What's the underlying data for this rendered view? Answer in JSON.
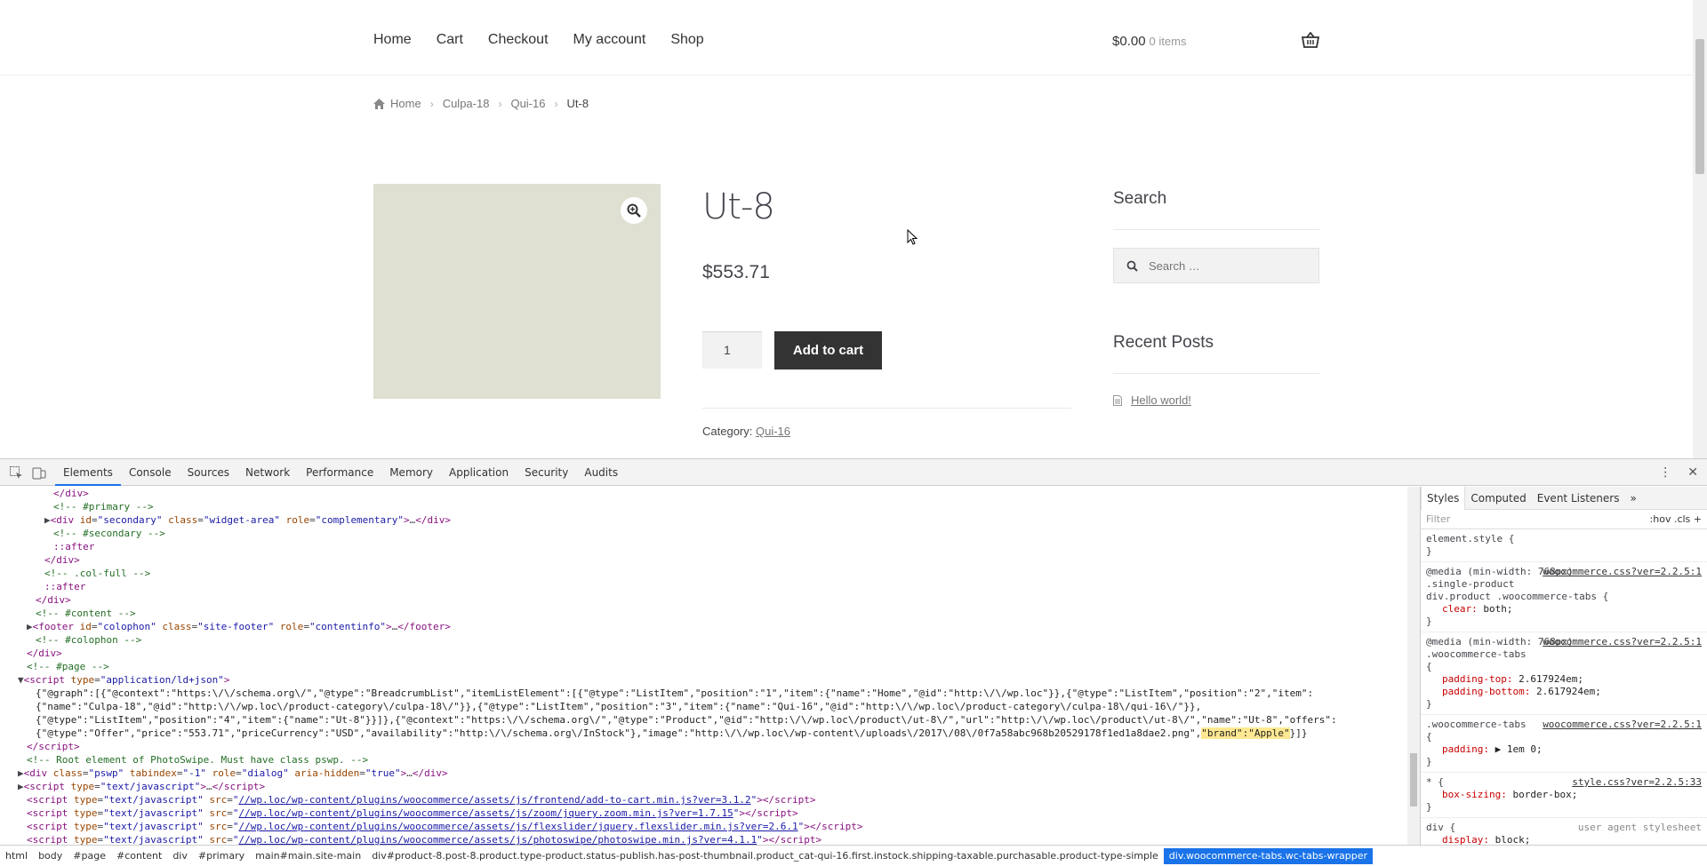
{
  "nav": [
    "Home",
    "Cart",
    "Checkout",
    "My account",
    "Shop"
  ],
  "cart": {
    "amount": "$0.00",
    "items": "0 items"
  },
  "breadcrumb": {
    "home": "Home",
    "c1": "Culpa-18",
    "c2": "Qui-16",
    "current": "Ut-8"
  },
  "product": {
    "title": "Ut-8",
    "price": "$553.71",
    "qty": "1",
    "add_to_cart": "Add to cart",
    "category_label": "Category:",
    "category": "Qui-16",
    "image_color": "#dfe0d2"
  },
  "sidebar": {
    "search_title": "Search",
    "search_placeholder": "Search …",
    "recent_title": "Recent Posts",
    "post": "Hello world!"
  },
  "devtools": {
    "tabs": [
      "Elements",
      "Console",
      "Sources",
      "Network",
      "Performance",
      "Memory",
      "Application",
      "Security",
      "Audits"
    ],
    "dom_lines": [
      {
        "indent": 6,
        "html": "<span class=\"tag\">&lt;/div&gt;</span>"
      },
      {
        "indent": 6,
        "html": "<span class=\"cmt\">&lt;!-- #primary --&gt;</span>"
      },
      {
        "indent": 5,
        "html": "▶<span class=\"tag\">&lt;div </span><span class=\"attr\">id</span>=<span class=\"val\">\"secondary\"</span> <span class=\"attr\">class</span>=<span class=\"val\">\"widget-area\"</span> <span class=\"attr\">role</span>=<span class=\"val\">\"complementary\"</span><span class=\"tag\">&gt;</span>…<span class=\"tag\">&lt;/div&gt;</span>"
      },
      {
        "indent": 6,
        "html": "<span class=\"cmt\">&lt;!-- #secondary --&gt;</span>"
      },
      {
        "indent": 6,
        "html": "<span class=\"pseudo\">::after</span>"
      },
      {
        "indent": 5,
        "html": "<span class=\"tag\">&lt;/div&gt;</span>"
      },
      {
        "indent": 5,
        "html": "<span class=\"cmt\">&lt;!-- .col-full --&gt;</span>"
      },
      {
        "indent": 5,
        "html": "<span class=\"pseudo\">::after</span>"
      },
      {
        "indent": 4,
        "html": "<span class=\"tag\">&lt;/div&gt;</span>"
      },
      {
        "indent": 4,
        "html": "<span class=\"cmt\">&lt;!-- #content --&gt;</span>"
      },
      {
        "indent": 3,
        "html": "▶<span class=\"tag\">&lt;footer </span><span class=\"attr\">id</span>=<span class=\"val\">\"colophon\"</span> <span class=\"attr\">class</span>=<span class=\"val\">\"site-footer\"</span> <span class=\"attr\">role</span>=<span class=\"val\">\"contentinfo\"</span><span class=\"tag\">&gt;</span>…<span class=\"tag\">&lt;/footer&gt;</span>"
      },
      {
        "indent": 4,
        "html": "<span class=\"cmt\">&lt;!-- #colophon --&gt;</span>"
      },
      {
        "indent": 3,
        "html": "<span class=\"tag\">&lt;/div&gt;</span>"
      },
      {
        "indent": 3,
        "html": "<span class=\"cmt\">&lt;!-- #page --&gt;</span>"
      },
      {
        "indent": 2,
        "html": "▼<span class=\"tag\">&lt;script </span><span class=\"attr\">type</span>=<span class=\"val\">\"application/ld+json\"</span><span class=\"tag\">&gt;</span>"
      },
      {
        "indent": 4,
        "html": "<span class=\"txt\">{\"@graph\":[{\"@context\":\"https:\\/\\/schema.org\\/\",\"@type\":\"BreadcrumbList\",\"itemListElement\":[{\"@type\":\"ListItem\",\"position\":\"1\",\"item\":{\"name\":\"Home\",\"@id\":\"http:\\/\\/wp.loc\"}},{\"@type\":\"ListItem\",\"position\":\"2\",\"item\":</span>"
      },
      {
        "indent": 4,
        "html": "<span class=\"txt\">{\"name\":\"Culpa-18\",\"@id\":\"http:\\/\\/wp.loc\\/product-category\\/culpa-18\\/\"}},{\"@type\":\"ListItem\",\"position\":\"3\",\"item\":{\"name\":\"Qui-16\",\"@id\":\"http:\\/\\/wp.loc\\/product-category\\/culpa-18\\/qui-16\\/\"}},</span>"
      },
      {
        "indent": 4,
        "html": "<span class=\"txt\">{\"@type\":\"ListItem\",\"position\":\"4\",\"item\":{\"name\":\"Ut-8\"}}]},{\"@context\":\"https:\\/\\/schema.org\\/\",\"@type\":\"Product\",\"@id\":\"http:\\/\\/wp.loc\\/product\\/ut-8\\/\",\"url\":\"http:\\/\\/wp.loc\\/product\\/ut-8\\/\",\"name\":\"Ut-8\",\"offers\":</span>"
      },
      {
        "indent": 4,
        "html": "<span class=\"txt\">{\"@type\":\"Offer\",\"price\":\"553.71\",\"priceCurrency\":\"USD\",\"availability\":\"http:\\/\\/schema.org\\/InStock\"},\"image\":\"http:\\/\\/wp.loc\\/wp-content\\/uploads\\/2017\\/08\\/0f7a58abc968b20529178f1ed1a8dae2.png\",</span><span class=\"txt hl\">\"brand\":\"Apple\"</span><span class=\"txt\">}]}</span>"
      },
      {
        "indent": 3,
        "html": "<span class=\"tag\">&lt;/script&gt;</span>"
      },
      {
        "indent": 3,
        "html": "<span class=\"cmt\">&lt;!-- Root element of PhotoSwipe. Must have class pswp. --&gt;</span>"
      },
      {
        "indent": 2,
        "html": "▶<span class=\"tag\">&lt;div </span><span class=\"attr\">class</span>=<span class=\"val\">\"pswp\"</span> <span class=\"attr\">tabindex</span>=<span class=\"val\">\"-1\"</span> <span class=\"attr\">role</span>=<span class=\"val\">\"dialog\"</span> <span class=\"attr\">aria-hidden</span>=<span class=\"val\">\"true\"</span><span class=\"tag\">&gt;</span>…<span class=\"tag\">&lt;/div&gt;</span>"
      },
      {
        "indent": 2,
        "html": "▶<span class=\"tag\">&lt;script </span><span class=\"attr\">type</span>=<span class=\"val\">\"text/javascript\"</span><span class=\"tag\">&gt;</span>…<span class=\"tag\">&lt;/script&gt;</span>"
      },
      {
        "indent": 3,
        "html": "<span class=\"tag\">&lt;script </span><span class=\"attr\">type</span>=<span class=\"val\">\"text/javascript\"</span> <span class=\"attr\">src</span>=<span class=\"val\">\"</span><span class=\"link\">//wp.loc/wp-content/plugins/woocommerce/assets/js/frontend/add-to-cart.min.js?ver=3.1.2</span><span class=\"val\">\"</span><span class=\"tag\">&gt;&lt;/script&gt;</span>"
      },
      {
        "indent": 3,
        "html": "<span class=\"tag\">&lt;script </span><span class=\"attr\">type</span>=<span class=\"val\">\"text/javascript\"</span> <span class=\"attr\">src</span>=<span class=\"val\">\"</span><span class=\"link\">//wp.loc/wp-content/plugins/woocommerce/assets/js/zoom/jquery.zoom.min.js?ver=1.7.15</span><span class=\"val\">\"</span><span class=\"tag\">&gt;&lt;/script&gt;</span>"
      },
      {
        "indent": 3,
        "html": "<span class=\"tag\">&lt;script </span><span class=\"attr\">type</span>=<span class=\"val\">\"text/javascript\"</span> <span class=\"attr\">src</span>=<span class=\"val\">\"</span><span class=\"link\">//wp.loc/wp-content/plugins/woocommerce/assets/js/flexslider/jquery.flexslider.min.js?ver=2.6.1</span><span class=\"val\">\"</span><span class=\"tag\">&gt;&lt;/script&gt;</span>"
      },
      {
        "indent": 3,
        "html": "<span class=\"tag\">&lt;script </span><span class=\"attr\">type</span>=<span class=\"val\">\"text/javascript\"</span> <span class=\"attr\">src</span>=<span class=\"val\">\"</span><span class=\"link\">//wp.loc/wp-content/plugins/woocommerce/assets/js/photoswipe/photoswipe.min.js?ver=4.1.1</span><span class=\"val\">\"</span><span class=\"tag\">&gt;&lt;/script&gt;</span>"
      }
    ],
    "styles_tabs": [
      "Styles",
      "Computed",
      "Event Listeners",
      "»"
    ],
    "filter": "Filter",
    "filter_opts": ":hov  .cls  +",
    "rules": [
      {
        "selector": "element.style {",
        "src": "",
        "props": [],
        "close": "}"
      },
      {
        "selector": "@media (min-width: 768px)\n.single-product\ndiv.product .woocommerce-tabs {",
        "src": "woocommerce.css?ver=2.2.5:1",
        "props": [
          [
            "clear",
            "both;"
          ]
        ],
        "close": "}"
      },
      {
        "selector": "@media (min-width: 768px)\n.woocommerce-tabs\n{",
        "src": "woocommerce.css?ver=2.2.5:1",
        "props": [
          [
            "padding-top",
            "2.617924em;"
          ],
          [
            "padding-bottom",
            "2.617924em;"
          ]
        ],
        "close": "}"
      },
      {
        "selector": ".woocommerce-tabs\n{",
        "src": "woocommerce.css?ver=2.2.5:1",
        "props": [
          [
            "padding",
            "▶ 1em 0;"
          ]
        ],
        "close": "}"
      },
      {
        "selector": "* {",
        "src": "style.css?ver=2.2.5:33",
        "props": [
          [
            "box-sizing",
            "border-box;"
          ]
        ],
        "close": "}"
      },
      {
        "selector": "div {",
        "src": "user agent stylesheet",
        "props": [
          [
            "display",
            "block;"
          ]
        ],
        "close": "}"
      }
    ],
    "crumbs": [
      "html",
      "body",
      "#page",
      "#content",
      "div",
      "#primary",
      "main#main.site-main",
      "div#product-8.post-8.product.type-product.status-publish.has-post-thumbnail.product_cat-qui-16.first.instock.shipping-taxable.purchasable.product-type-simple",
      "div.woocommerce-tabs.wc-tabs-wrapper"
    ]
  }
}
